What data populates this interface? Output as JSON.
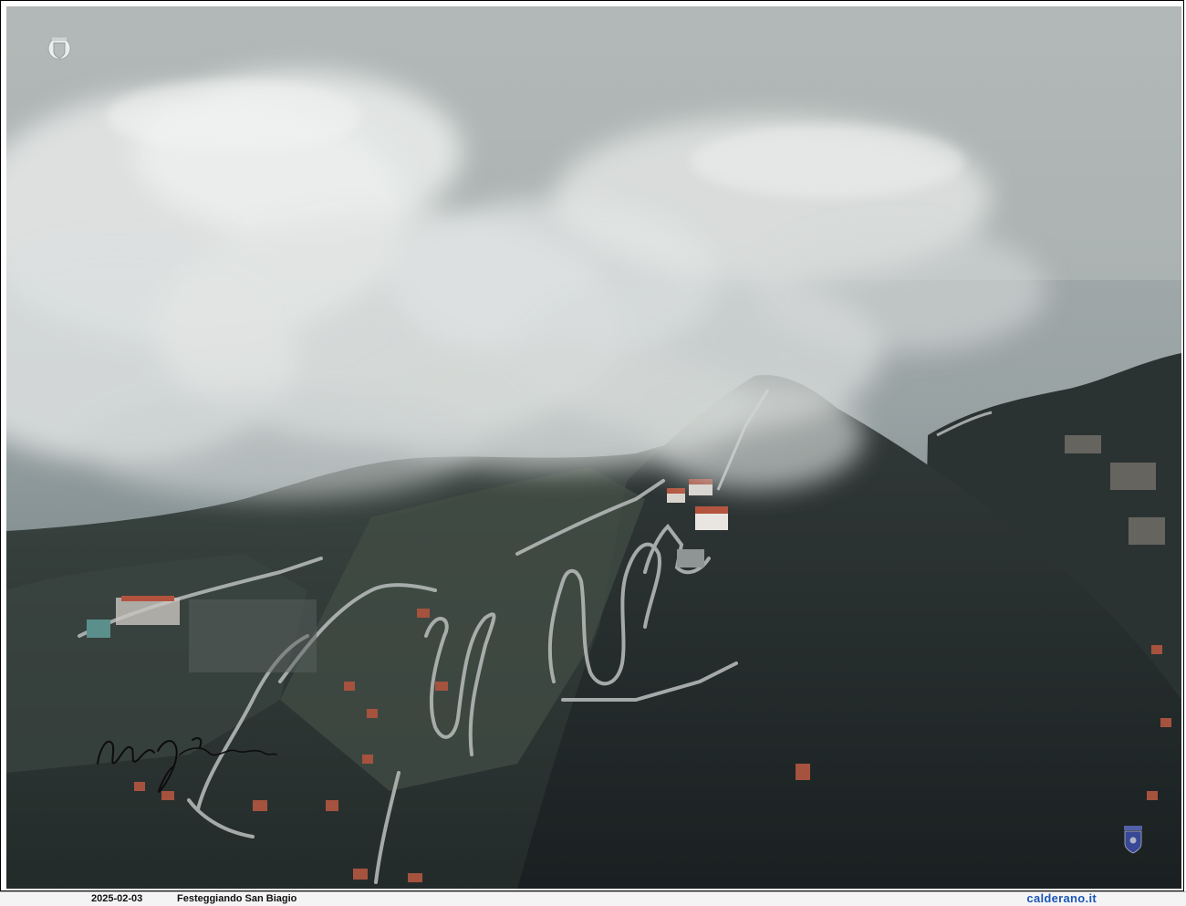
{
  "caption": {
    "date": "2025-02-03",
    "title": "Festeggiando San Biagio",
    "site_name": "calderano",
    "site_suffix": ".it"
  },
  "photo": {
    "subject": "aerial-mountain-coast-fog",
    "colors": {
      "sea": "#8b9698",
      "fog": "#d8dcdc",
      "mountain": "#1f2627",
      "road": "#a9aeae",
      "roof": "#b4533d"
    }
  },
  "icons": {
    "top_logo": "crest-logo-icon",
    "bottom_logo": "coat-of-arms-icon",
    "signature": "handwritten-signature"
  }
}
